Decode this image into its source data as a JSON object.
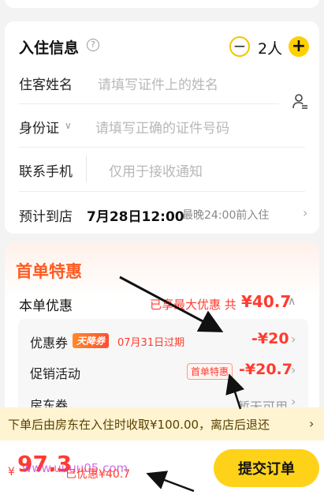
{
  "checkin": {
    "title": "入住信息",
    "help_icon": "question-circle-icon",
    "guest_count": "2人",
    "fields": [
      {
        "label": "住客姓名",
        "placeholder": "请填写证件上的姓名"
      },
      {
        "label": "身份证",
        "placeholder": "请填写正确的证件号码"
      },
      {
        "label": "联系手机",
        "placeholder": "仅用于接收通知"
      }
    ],
    "arrival": {
      "label": "预计到店",
      "value": "7月28日12:00",
      "note": "最晚24:00前入住"
    }
  },
  "promo": {
    "title": "首单特惠",
    "order_discount": {
      "label": "本单优惠",
      "prefix": "已享最大优惠 共",
      "amount": "¥40.7"
    },
    "rows": [
      {
        "label": "优惠券",
        "badge": "天降券",
        "expiry": "07月31日过期",
        "amount": "-¥20"
      },
      {
        "label": "促销活动",
        "tag": "首单特惠",
        "amount": "-¥20.7"
      },
      {
        "label": "房东券",
        "status": "暂无可用"
      }
    ]
  },
  "notice": {
    "text": "下单后由房东在入住时收取¥100.00，离店后退还"
  },
  "footer": {
    "currency": "¥",
    "total": "97.3",
    "watermark": "www.uuuu05.com",
    "discount_note": "已优惠¥40.7",
    "submit_label": "提交订单"
  },
  "colors": {
    "accent": "#ffd21a",
    "price": "#ff3b2f",
    "promo_title": "#ff5a1f"
  }
}
